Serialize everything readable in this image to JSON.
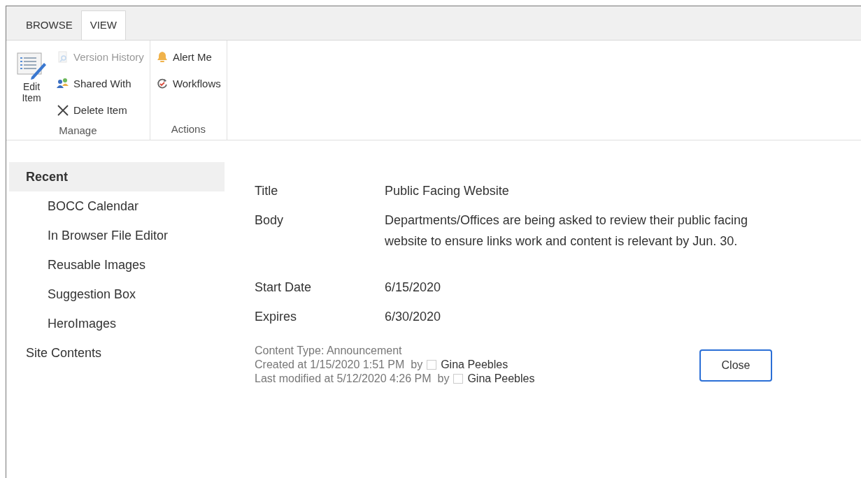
{
  "tabs": [
    {
      "label": "BROWSE",
      "selected": false
    },
    {
      "label": "VIEW",
      "selected": true
    }
  ],
  "ribbon": {
    "groups": [
      {
        "label": "Manage",
        "large": {
          "label": "Edit Item",
          "kind": "edit"
        },
        "items": [
          {
            "label": "Version History",
            "kind": "history",
            "disabled": true
          },
          {
            "label": "Shared With",
            "kind": "people",
            "disabled": false
          },
          {
            "label": "Delete Item",
            "kind": "delete",
            "disabled": false
          }
        ]
      },
      {
        "label": "Actions",
        "items": [
          {
            "label": "Alert Me",
            "kind": "bell",
            "disabled": false
          },
          {
            "label": "Workflows",
            "kind": "workflow",
            "disabled": false
          }
        ]
      }
    ]
  },
  "sidebar": {
    "items": [
      {
        "label": "Recent",
        "selected": true,
        "children": [
          {
            "label": "BOCC Calendar"
          },
          {
            "label": "In Browser File Editor"
          },
          {
            "label": "Reusable Images"
          },
          {
            "label": "Suggestion Box"
          },
          {
            "label": "HeroImages"
          }
        ]
      },
      {
        "label": "Site Contents",
        "selected": false
      }
    ]
  },
  "fields": [
    {
      "label": "Title",
      "value": "Public Facing Website"
    },
    {
      "label": "Body",
      "value": "Departments/Offices are being asked to review their public facing website to ensure links work and content is relevant by Jun. 30."
    },
    {
      "label": "Start Date",
      "value": "6/15/2020"
    },
    {
      "label": "Expires",
      "value": "6/30/2020"
    }
  ],
  "footer": {
    "content_type": "Content Type: Announcement",
    "created": {
      "text": "Created at 1/15/2020 1:51 PM  by",
      "user": "Gina Peebles"
    },
    "modified": {
      "text": "Last modified at 5/12/2020 4:26 PM  by",
      "user": "Gina Peebles"
    }
  },
  "close_button": "Close"
}
